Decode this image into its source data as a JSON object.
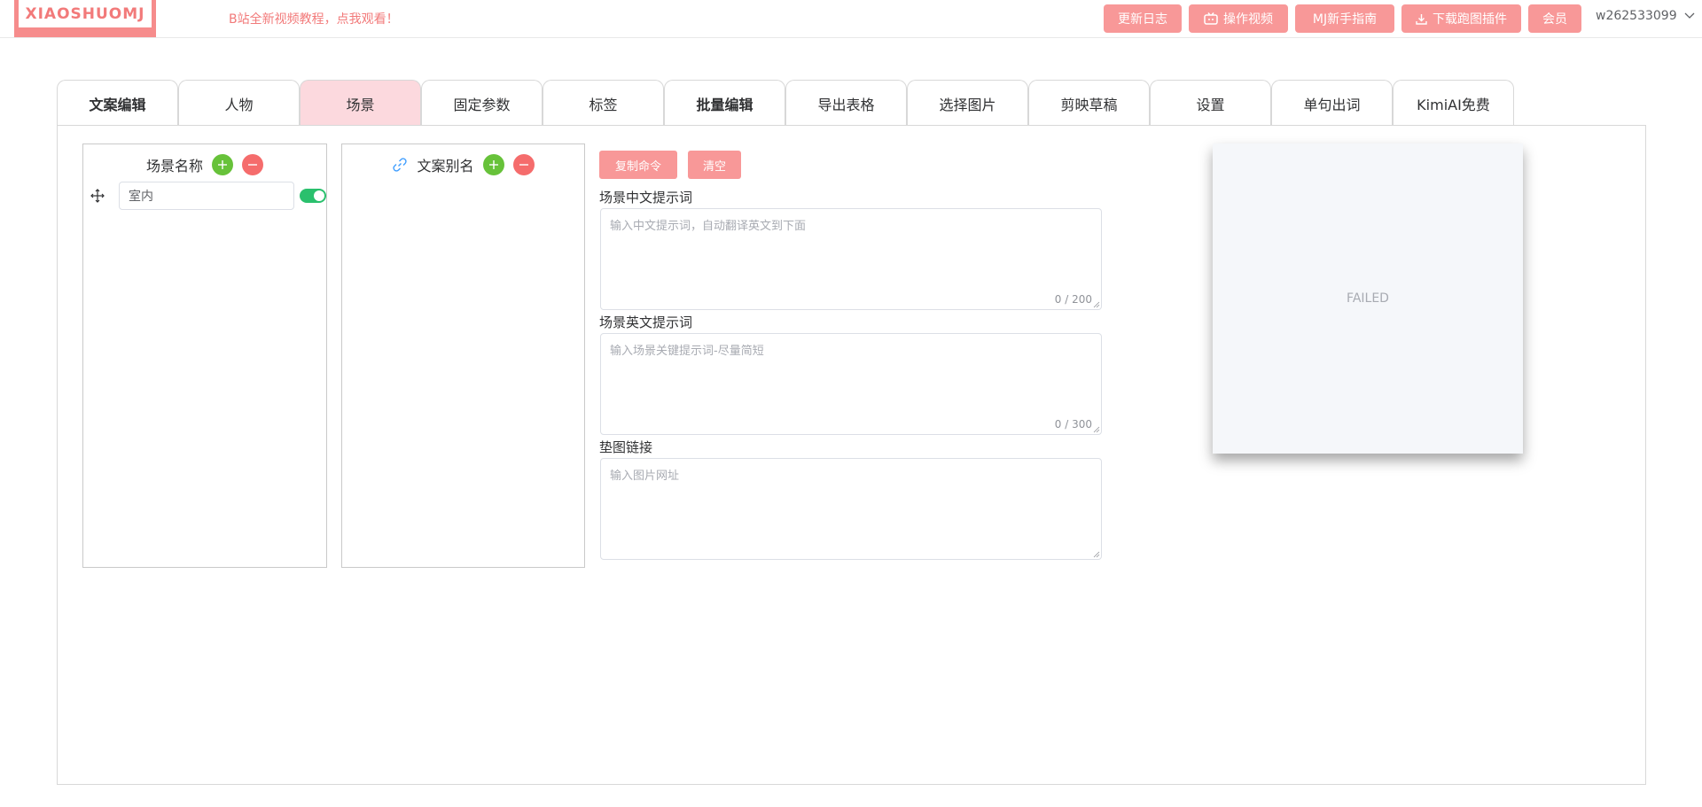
{
  "header": {
    "logo_text": "XIAOSHUOMJ",
    "promo": "B站全新视频教程，点我观看！",
    "buttons": {
      "changelog": "更新日志",
      "video": "操作视频",
      "guide": "MJ新手指南",
      "plugin": "下载跑图插件",
      "member": "会员"
    },
    "username": "w262533099"
  },
  "tabs": [
    "文案编辑",
    "人物",
    "场景",
    "固定参数",
    "标签",
    "批量编辑",
    "导出表格",
    "选择图片",
    "剪映草稿",
    "设置",
    "单句出词",
    "KimiAI免费"
  ],
  "active_tab": "场景",
  "scene_list": {
    "title": "场景名称",
    "items": [
      {
        "name": "室内",
        "enabled": true
      }
    ]
  },
  "alias_list": {
    "title": "文案别名"
  },
  "actions": {
    "copy": "复制命令",
    "clear": "清空"
  },
  "fields": {
    "cn_label": "场景中文提示词",
    "cn_placeholder": "输入中文提示词，自动翻译英文到下面",
    "cn_counter": "0 / 200",
    "en_label": "场景英文提示词",
    "en_placeholder": "输入场景关键提示词-尽量简短",
    "en_counter": "0 / 300",
    "img_label": "垫图链接",
    "img_placeholder": "输入图片网址"
  },
  "preview": {
    "status": "FAILED"
  },
  "colors": {
    "accent": "#f89898",
    "active_tab": "#fcd9de",
    "add": "#67c23a",
    "remove": "#f56c6c",
    "switch_on": "#2ac06d"
  }
}
